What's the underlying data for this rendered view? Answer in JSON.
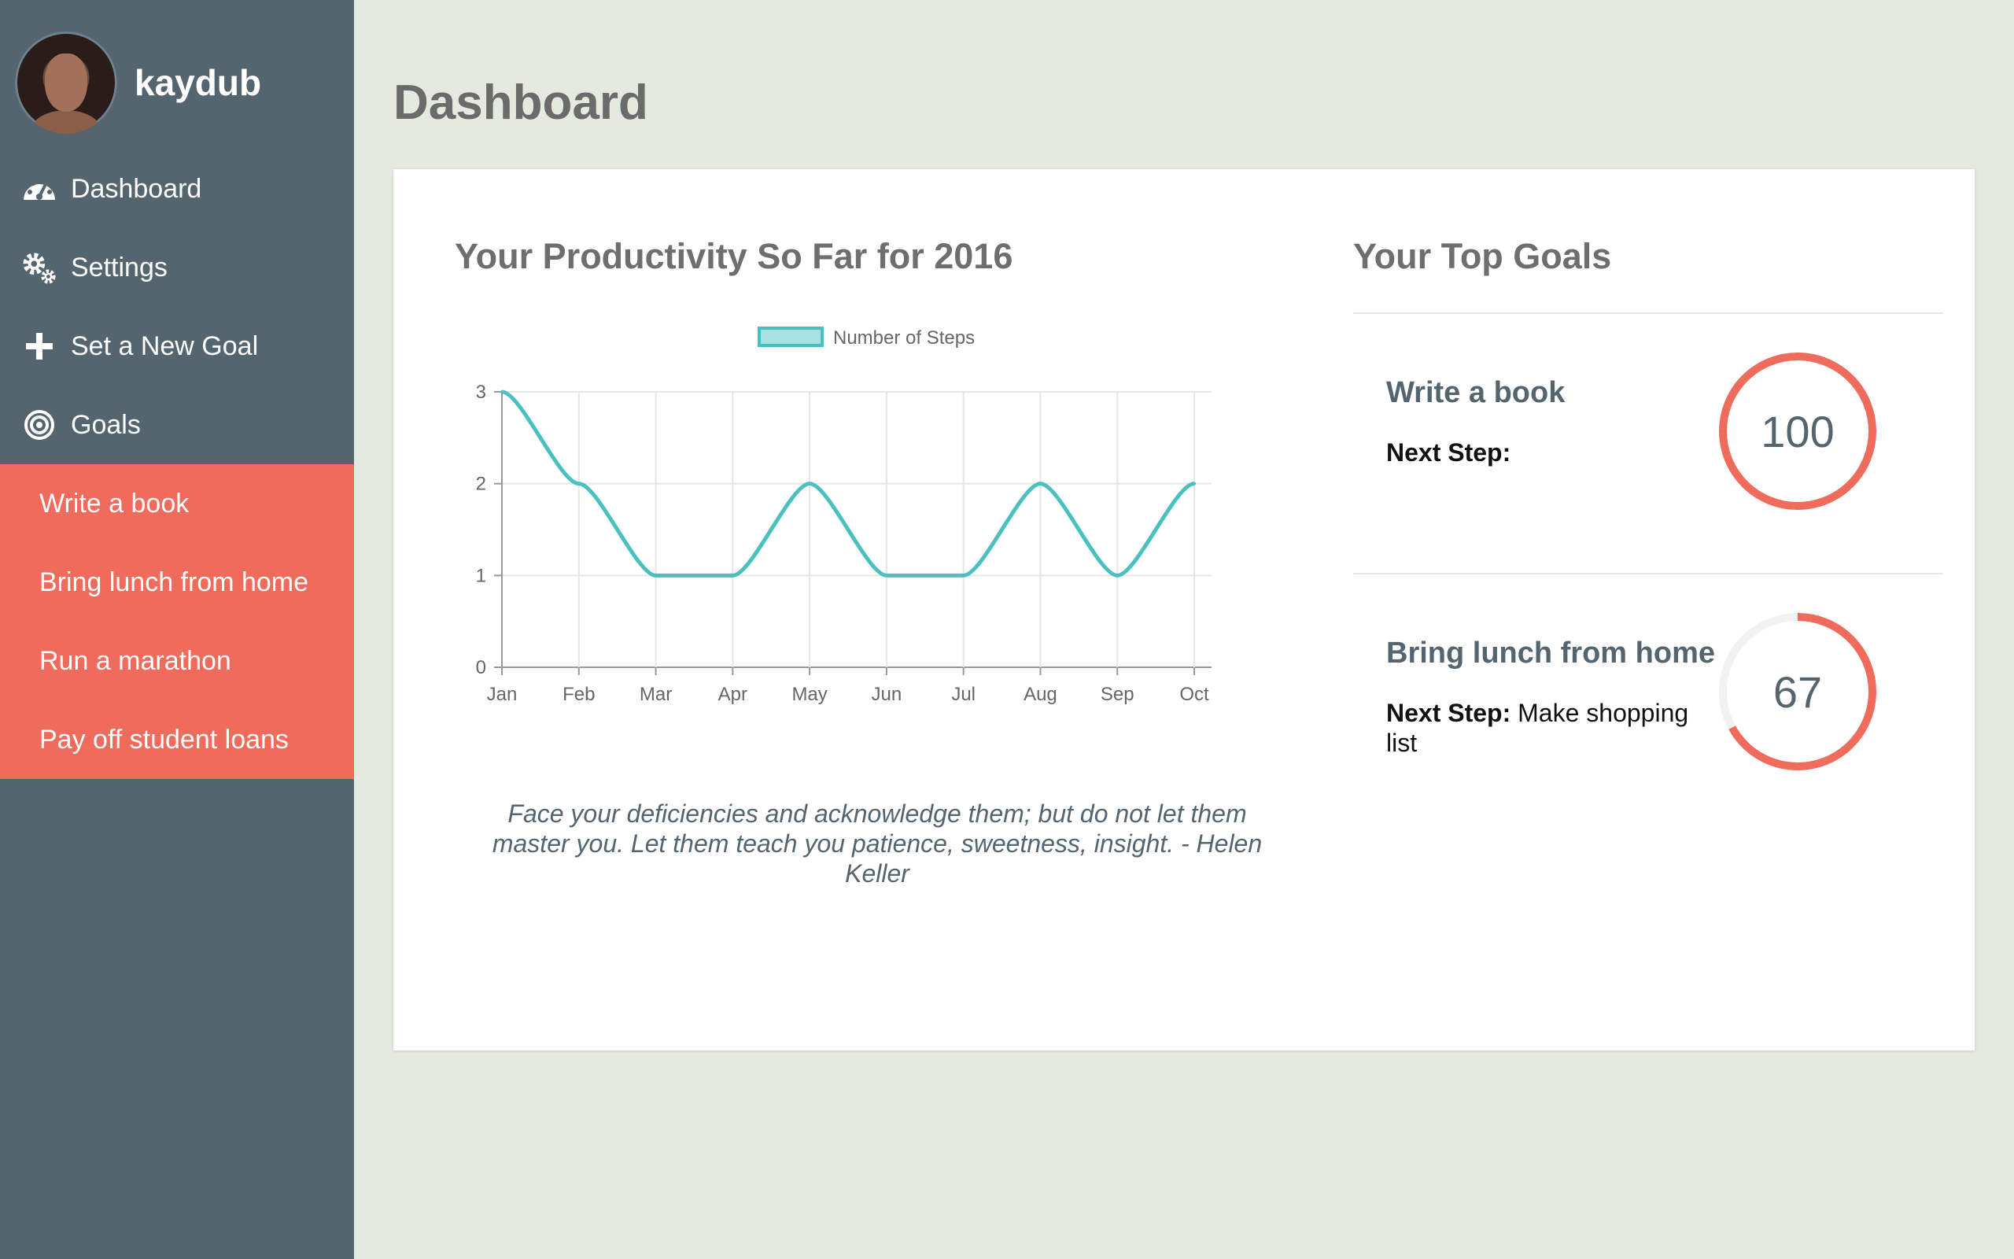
{
  "sidebar": {
    "username": "kaydub",
    "nav": [
      {
        "label": "Dashboard",
        "icon": "dashboard-gauge-icon"
      },
      {
        "label": "Settings",
        "icon": "gears-icon"
      },
      {
        "label": "Set a New Goal",
        "icon": "plus-icon"
      },
      {
        "label": "Goals",
        "icon": "target-icon"
      }
    ],
    "goals": [
      "Write a book",
      "Bring lunch from home",
      "Run a marathon",
      "Pay off student loans"
    ],
    "colors": {
      "background": "#54656f",
      "goals_background": "#ef6b5b"
    }
  },
  "page": {
    "title": "Dashboard"
  },
  "productivity": {
    "title": "Your Productivity So Far for 2016",
    "quote": "Face your deficiencies and acknowledge them; but do not let them master you. Let them teach you patience, sweetness, insight. - Helen Keller"
  },
  "chart_data": {
    "type": "line",
    "categories": [
      "Jan",
      "Feb",
      "Mar",
      "Apr",
      "May",
      "Jun",
      "Jul",
      "Aug",
      "Sep",
      "Oct"
    ],
    "series": [
      {
        "name": "Number of Steps",
        "values": [
          3,
          2,
          1,
          1,
          2,
          1,
          1,
          2,
          1,
          2
        ],
        "color": "#4bc0c0"
      }
    ],
    "ylim": [
      0,
      3
    ],
    "yticks": [
      0,
      1,
      2,
      3
    ],
    "grid": true,
    "legend": "top-center",
    "title": "",
    "xlabel": "",
    "ylabel": ""
  },
  "top_goals": {
    "title": "Your Top Goals",
    "next_step_label": "Next Step:",
    "items": [
      {
        "name": "Write a book",
        "next_step": "",
        "progress": 100
      },
      {
        "name": "Bring lunch from home",
        "next_step": "Make shopping list",
        "progress": 67
      }
    ],
    "ring_color": "#ef6b5b"
  }
}
